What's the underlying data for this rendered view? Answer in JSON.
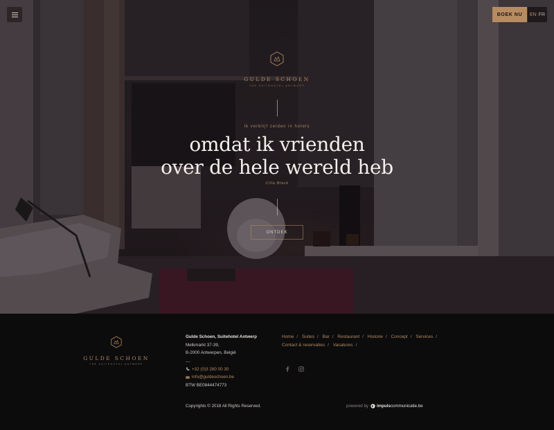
{
  "header": {
    "menu_icon": "hamburger-menu-icon",
    "book_label": "BOEK NU",
    "languages": [
      "EN",
      "FR"
    ],
    "active_language": "EN"
  },
  "hero": {
    "brand_name": "GULDE SCHOEN",
    "brand_sub": "THE SUITEHOTEL ANTWERP",
    "kicker": "Ik verblijf zelden in hotels",
    "headline_line1": "omdat ik vrienden",
    "headline_line2": "over de hele wereld heb",
    "author": "Cilla Black",
    "cta_label": "ONTDEK"
  },
  "footer": {
    "brand_name": "GULDE SCHOEN",
    "brand_sub": "THE SUITEHOTEL ANTWERP",
    "address": {
      "name": "Gulde Schoen, Suitehotel Antwerp",
      "street": "Melkmarkt 37-39,",
      "city": "B-2000 Antwerpen, België",
      "phone": "+32 (0)3 280 00 30",
      "email": "info@guldeschoen.be",
      "vat": "BTW BE0844474773"
    },
    "nav": [
      "Home",
      "Suites",
      "Bar",
      "Restaurant",
      "Historie",
      "Concept",
      "Services",
      "Contact & reservaties",
      "Vacatures"
    ],
    "social_icons": [
      "facebook-icon",
      "instagram-icon"
    ],
    "copyright": "Copyrights © 2018 All Rights Reserved.",
    "powered_by": "powered by",
    "agency_bold": "impuls",
    "agency_rest": "communicatie.be"
  },
  "colors": {
    "accent": "#b88c63",
    "footer_bg": "#0c0c0d",
    "headline": "#f4f0ec"
  }
}
